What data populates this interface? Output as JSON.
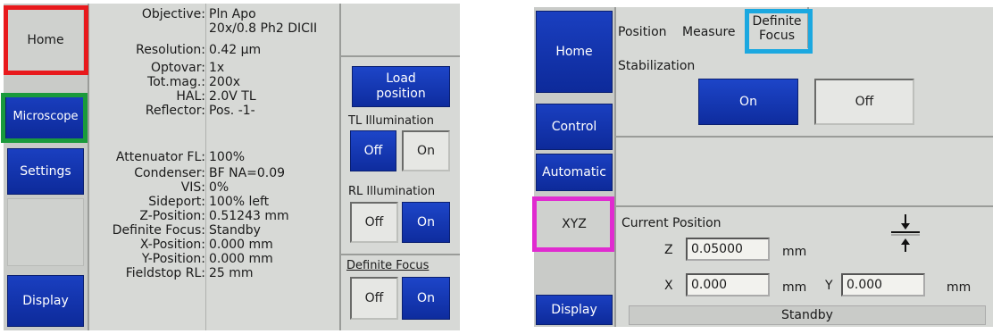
{
  "left_panel": {
    "nav": {
      "home": "Home",
      "microscope": "Microscope",
      "settings": "Settings",
      "display": "Display"
    },
    "info_rows": [
      {
        "label": "Objective:",
        "value": "Pln Apo"
      },
      {
        "label": "",
        "value": "20x/0.8 Ph2 DICII"
      },
      {
        "label": "Resolution:",
        "value": "0.42 µm"
      },
      {
        "label": "Optovar:",
        "value": "1x"
      },
      {
        "label": "Tot.mag.:",
        "value": "200x"
      },
      {
        "label": "HAL:",
        "value": "2.0V    TL"
      },
      {
        "label": "Reflector:",
        "value": "Pos. -1-"
      },
      {
        "label": "Attenuator FL:",
        "value": "100%"
      },
      {
        "label": "Condenser:",
        "value": "BF         NA=0.09"
      },
      {
        "label": "VIS:",
        "value": "0%"
      },
      {
        "label": "Sideport:",
        "value": "100%   left"
      },
      {
        "label": "Z-Position:",
        "value": "0.51243 mm"
      },
      {
        "label": "Definite Focus:",
        "value": "Standby"
      },
      {
        "label": "X-Position:",
        "value": "0.000 mm"
      },
      {
        "label": "Y-Position:",
        "value": "0.000 mm"
      },
      {
        "label": "Fieldstop RL:",
        "value": "25 mm"
      }
    ],
    "load_position": "Load position",
    "tl_illumination": {
      "title": "TL Illumination",
      "off": "Off",
      "on": "On",
      "active": "off"
    },
    "rl_illumination": {
      "title": "RL Illumination",
      "off": "Off",
      "on": "On",
      "active": "on"
    },
    "definite_focus": {
      "title": "Definite Focus",
      "off": "Off",
      "on": "On",
      "active": "on"
    }
  },
  "right_panel": {
    "nav": {
      "home": "Home",
      "control": "Control",
      "automatic": "Automatic",
      "xyz": "XYZ",
      "display": "Display"
    },
    "tabs": {
      "position": "Position",
      "measure": "Measure",
      "definite_focus_line1": "Definite",
      "definite_focus_line2": "Focus"
    },
    "stabilization": {
      "title": "Stabilization",
      "on": "On",
      "off": "Off",
      "active": "on"
    },
    "current_position": {
      "title": "Current Position",
      "z_label": "Z",
      "z_value": "0.05000",
      "z_unit": "mm",
      "x_label": "X",
      "x_value": "0.000",
      "x_unit": "mm",
      "y_label": "Y",
      "y_value": "0.000",
      "y_unit": "mm"
    },
    "status": "Standby"
  },
  "highlight_colors": {
    "home": "#e8191c",
    "microscope": "#1a9a3c",
    "definite_focus_tab": "#1ba8e0",
    "xyz": "#e02bd0"
  }
}
